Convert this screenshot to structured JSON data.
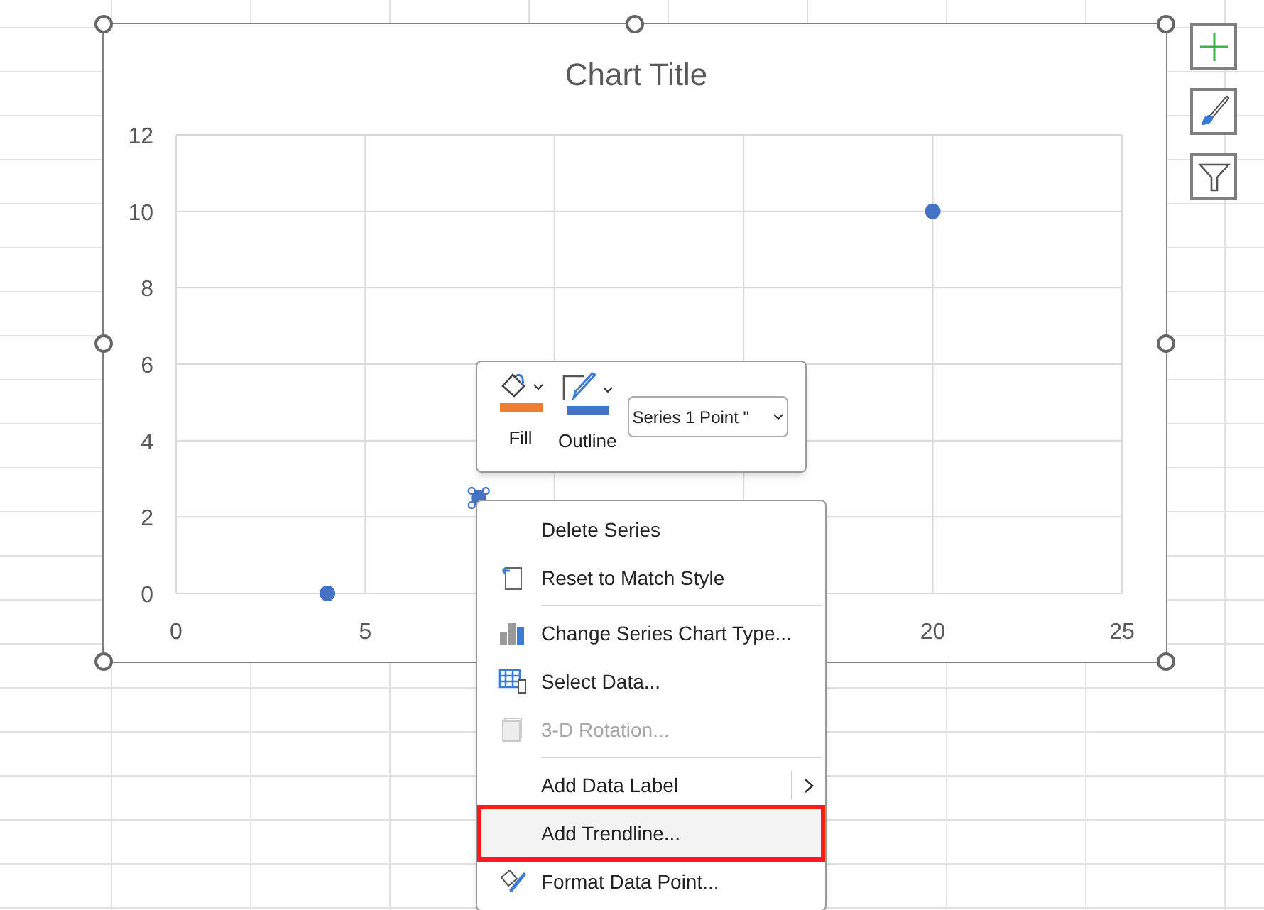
{
  "chart": {
    "chart_data": {
      "type": "scatter",
      "title": "Chart Title",
      "x": [
        4,
        8,
        20
      ],
      "series": [
        {
          "color": "#4472c4",
          "values": [
            0,
            2.5,
            10
          ]
        }
      ],
      "xlim": [
        0,
        25
      ],
      "ylim": [
        0,
        12
      ],
      "xticks": [
        0,
        5,
        20,
        25
      ],
      "yticks": [
        0,
        2,
        4,
        6,
        8,
        10,
        12
      ],
      "grid": true
    },
    "points": [
      {
        "selected": false
      },
      {
        "selected": true
      },
      {
        "selected": false
      }
    ]
  },
  "side_buttons": [
    {
      "kind": "elements"
    },
    {
      "kind": "styles"
    },
    {
      "kind": "filters"
    }
  ],
  "mini_toolbar": {
    "buttons": [
      {
        "label": "Fill",
        "kind": "fill",
        "color": "#ed7d31"
      },
      {
        "label": "Outline",
        "kind": "outline",
        "color": "#4472c4"
      }
    ],
    "selector": {
      "value": "Series 1 Point \""
    }
  },
  "context_menu": {
    "groups": [
      [
        {
          "label": "Delete Series",
          "disabled": false,
          "submenu": false,
          "highlighted": false
        },
        {
          "label": "Reset to Match Style",
          "disabled": false,
          "submenu": false,
          "highlighted": false
        }
      ],
      [
        {
          "label": "Change Series Chart Type...",
          "disabled": false,
          "submenu": false,
          "highlighted": false
        },
        {
          "label": "Select Data...",
          "disabled": false,
          "submenu": false,
          "highlighted": false
        },
        {
          "label": "3-D Rotation...",
          "disabled": true,
          "submenu": false,
          "highlighted": false
        }
      ],
      [
        {
          "label": "Add Data Label",
          "disabled": false,
          "submenu": true,
          "highlighted": false
        },
        {
          "label": "Add Trendline...",
          "disabled": false,
          "submenu": false,
          "highlighted": true
        },
        {
          "label": "Format Data Point...",
          "disabled": false,
          "submenu": false,
          "highlighted": false
        }
      ]
    ]
  }
}
